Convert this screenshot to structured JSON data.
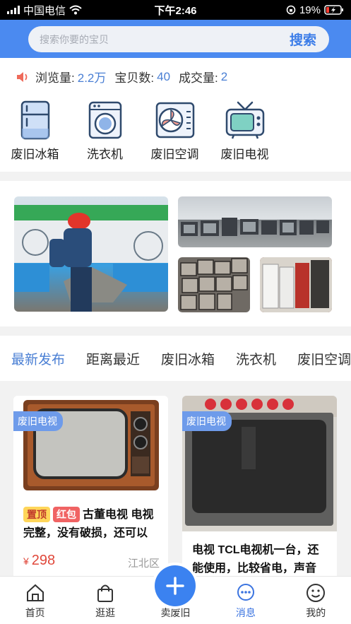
{
  "status_bar": {
    "carrier": "中国电信",
    "time": "下午2:46",
    "battery": "19%"
  },
  "search": {
    "placeholder": "搜索你要的宝贝",
    "button": "搜索"
  },
  "stats": {
    "views_label": "浏览量:",
    "views_value": "2.2万",
    "items_label": "宝贝数:",
    "items_value": "40",
    "deals_label": "成交量:",
    "deals_value": "2"
  },
  "categories": [
    {
      "label": "废旧冰箱",
      "icon": "fridge-icon"
    },
    {
      "label": "洗衣机",
      "icon": "washing-machine-icon"
    },
    {
      "label": "废旧空调",
      "icon": "air-conditioner-icon"
    },
    {
      "label": "废旧电视",
      "icon": "tv-icon"
    }
  ],
  "tabs": [
    "最新发布",
    "距离最近",
    "废旧冰箱",
    "洗衣机",
    "废旧空调"
  ],
  "active_tab": "最新发布",
  "products": [
    {
      "tag": "废旧电视",
      "badge_top": "置顶",
      "badge_red": "红包",
      "desc": "古董电视 电视完整，没有破损，还可以",
      "price_symbol": "¥",
      "price": "298",
      "location": "江北区"
    },
    {
      "tag": "废旧电视",
      "desc": "电视 TCL电视机一台，还能使用，比较省电，声音"
    }
  ],
  "nav": {
    "home": "首页",
    "browse": "逛逛",
    "sell": "卖废旧",
    "messages": "消息",
    "mine": "我的"
  },
  "colors": {
    "accent": "#4b8af0",
    "price": "#e0483b",
    "active": "#3b74e0"
  }
}
